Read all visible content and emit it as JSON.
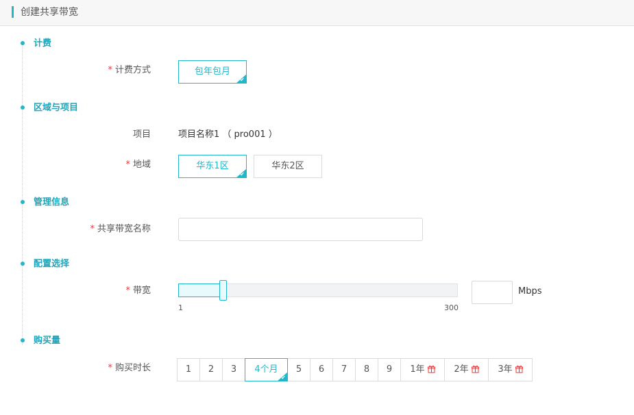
{
  "header": {
    "title": "创建共享带宽"
  },
  "sections": {
    "billing": "计费",
    "region": "区域与项目",
    "management": "管理信息",
    "config": "配置选择",
    "purchase": "购买量"
  },
  "billing": {
    "label": "计费方式",
    "option": "包年包月"
  },
  "project": {
    "label": "项目",
    "value": "项目名称1 （ pro001 ）"
  },
  "region": {
    "label": "地域",
    "options": [
      "华东1区",
      "华东2区"
    ],
    "selected": "华东1区"
  },
  "management": {
    "name_label": "共享带宽名称",
    "name_value": ""
  },
  "bandwidth": {
    "label": "带宽",
    "min": "1",
    "max": "300",
    "slider_fraction": 0.16,
    "unit": "Mbps",
    "value": ""
  },
  "duration": {
    "label": "购买时长",
    "options": [
      "1",
      "2",
      "3",
      "4个月",
      "5",
      "6",
      "7",
      "8",
      "9",
      "1年",
      "2年",
      "3年"
    ],
    "selected": "4个月",
    "gift_options": [
      "1年",
      "2年",
      "3年"
    ]
  },
  "icons": {
    "check": "check-icon",
    "gift": "gift-icon"
  },
  "colors": {
    "accent": "#1fb7c9",
    "required": "#e4393c",
    "gift": "#e4393c"
  }
}
